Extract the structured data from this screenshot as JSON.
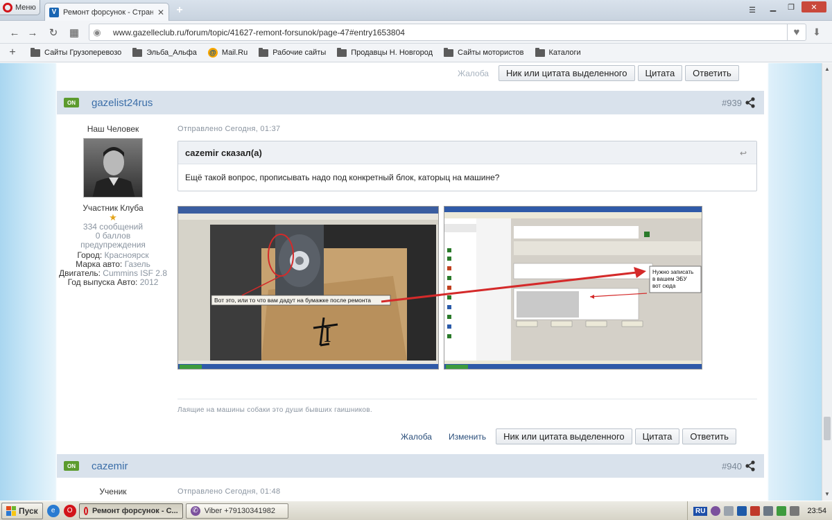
{
  "browser": {
    "menu_label": "Меню",
    "tab_title": "Ремонт форсунок - Страница",
    "url": "www.gazelleclub.ru/forum/topic/41627-remont-forsunok/page-47#entry1653804"
  },
  "bookmarks": [
    {
      "label": "Сайты Грузоперевозо",
      "icon": "folder-icon"
    },
    {
      "label": "Эльба_Альфа",
      "icon": "folder-icon"
    },
    {
      "label": "Mail.Ru",
      "icon": "mailru-icon"
    },
    {
      "label": "Рабочие сайты",
      "icon": "folder-icon"
    },
    {
      "label": "Продавцы Н. Новгород",
      "icon": "folder-icon"
    },
    {
      "label": "Сайты мотористов",
      "icon": "folder-icon"
    },
    {
      "label": "Каталоги",
      "icon": "folder-icon"
    }
  ],
  "top_actions": {
    "report": "Жалоба",
    "nick_quote": "Ник или цитата выделенного",
    "quote": "Цитата",
    "reply": "Ответить"
  },
  "post1": {
    "badge": "ON",
    "author": "gazelist24rus",
    "number": "#939",
    "rank": "Наш Человек",
    "member_title": "Участник Клуба",
    "star": "★",
    "posts_count": "334 сообщений",
    "warnings": "0 баллов предупреждения",
    "city_label": "Город:",
    "city": "Красноярск",
    "car_label": "Марка авто:",
    "car": "Газель",
    "engine_label": "Двигатель:",
    "engine": "Cummins ISF 2.8",
    "year_label": "Год выпуска Авто:",
    "year": "2012",
    "sent": "Отправлено Сегодня, 01:37",
    "quote_author": "cazemir сказал(а)",
    "quote_text": "Ещё такой вопрос, прописывать надо под конкретный блок, каторыц на машине?",
    "img1_caption": "Вот это, или то что вам дадут на бумажке после ремонта",
    "img1_mark": "I",
    "img2_callout_1": "Нужно записать",
    "img2_callout_2": "в вашем ЭБУ",
    "img2_callout_3": "вот сюда",
    "signature": "Лаящие на машины собаки это души бывших гаишников.",
    "actions": {
      "report": "Жалоба",
      "edit": "Изменить",
      "nick_quote": "Ник или цитата выделенного",
      "quote": "Цитата",
      "reply": "Ответить"
    }
  },
  "post2": {
    "badge": "ON",
    "author": "cazemir",
    "number": "#940",
    "rank": "Ученик",
    "sent": "Отправлено Сегодня, 01:48"
  },
  "taskbar": {
    "start": "Пуск",
    "tasks": [
      {
        "label": "Ремонт форсунок - С...",
        "active": true
      },
      {
        "label": "Viber +79130341982",
        "active": false
      }
    ],
    "lang": "RU",
    "clock": "23:54"
  },
  "colors": {
    "accent_link": "#3b6ea8",
    "header_bg": "#d9e2ec",
    "online_badge": "#5c9b2e",
    "arrow_red": "#d42a2a"
  }
}
